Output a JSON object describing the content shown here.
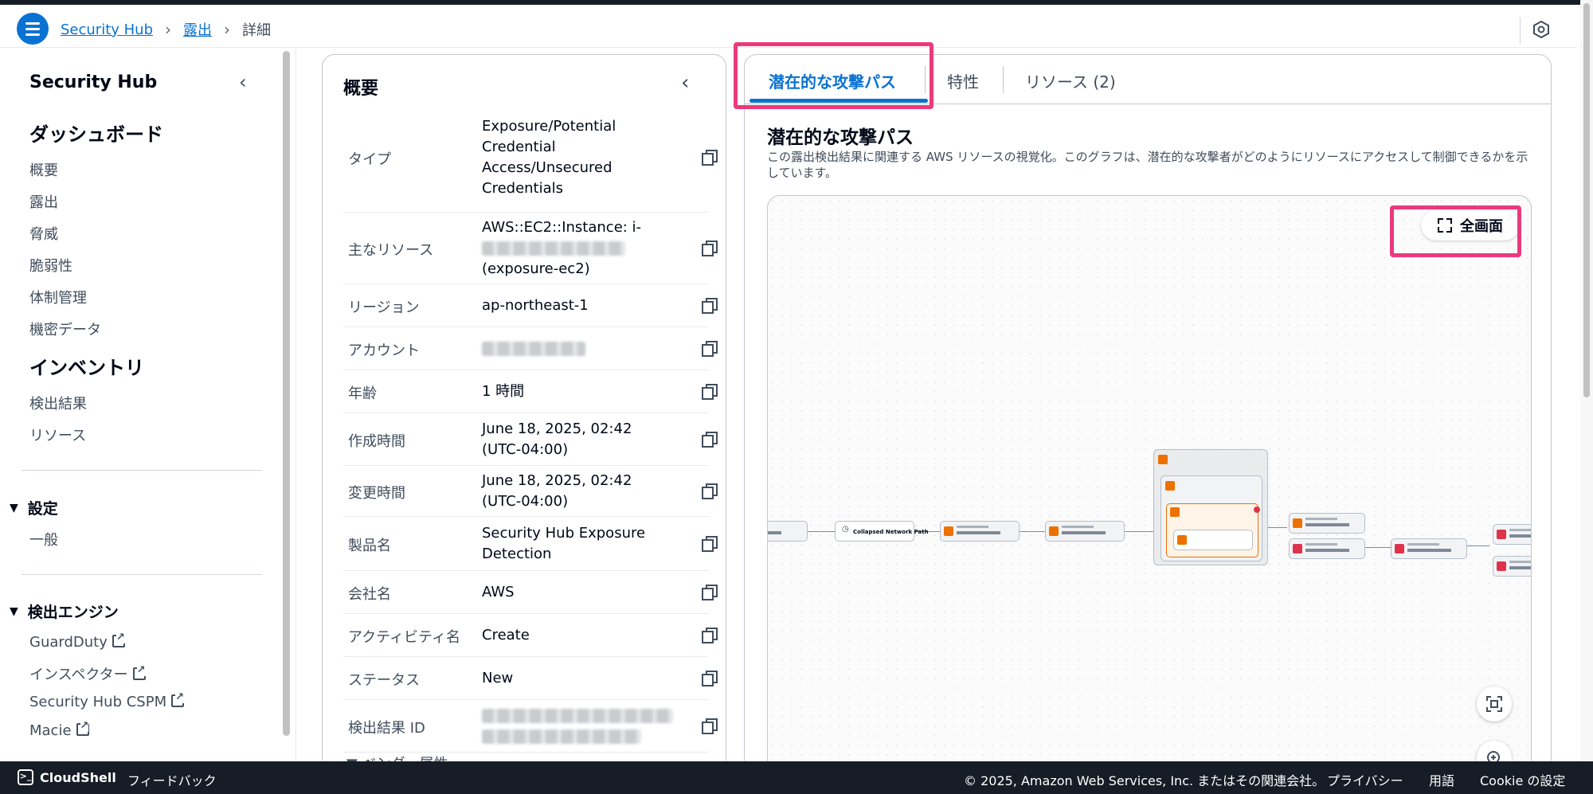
{
  "breadcrumb": [
    "Security Hub",
    "露出",
    "詳細"
  ],
  "sidebar": {
    "title": "Security Hub",
    "dashboard_heading": "ダッシュボード",
    "dashboard_items": [
      "概要",
      "露出",
      "脅威",
      "脆弱性",
      "体制管理",
      "機密データ"
    ],
    "inventory_heading": "インベントリ",
    "inventory_items": [
      "検出結果",
      "リソース"
    ],
    "settings_heading": "設定",
    "settings_items": [
      "一般"
    ],
    "engines_heading": "検出エンジン",
    "engine_items": [
      "GuardDuty",
      "インスペクター",
      "Security Hub CSPM",
      "Macie"
    ]
  },
  "overview": {
    "title": "概要",
    "rows": [
      {
        "key": "タイプ",
        "value": "Exposure/Potential Credential Access/Unsecured Credentials"
      },
      {
        "key": "主なリソース",
        "value_prefix": "AWS::EC2::Instance: i-",
        "value_suffix": "(exposure-ec2)"
      },
      {
        "key": "リージョン",
        "value": "ap-northeast-1"
      },
      {
        "key": "アカウント",
        "value": ""
      },
      {
        "key": "年齢",
        "value": "1 時間"
      },
      {
        "key": "作成時間",
        "value": "June 18, 2025, 02:42 (UTC-04:00)"
      },
      {
        "key": "変更時間",
        "value": "June 18, 2025, 02:42 (UTC-04:00)"
      },
      {
        "key": "製品名",
        "value": "Security Hub Exposure Detection"
      },
      {
        "key": "会社名",
        "value": "AWS"
      },
      {
        "key": "アクティビティ名",
        "value": "Create"
      },
      {
        "key": "ステータス",
        "value": "New"
      },
      {
        "key": "検出結果 ID",
        "value": ""
      }
    ],
    "vendor_attrs": "ベンダー属性"
  },
  "tabs": [
    {
      "label": "潜在的な攻撃パス",
      "active": true
    },
    {
      "label": "特性",
      "active": false
    },
    {
      "label": "リソース (2)",
      "active": false
    }
  ],
  "attack_path": {
    "title": "潜在的な攻撃パス",
    "description": "この露出検出結果に関連する AWS リソースの視覚化。このグラフは、潜在的な攻撃者がどのようにリソースにアクセスして制御できるかを示しています。",
    "fullscreen_label": "全画面",
    "collapsed_node_label": "Collapsed Network Path"
  },
  "footer": {
    "cloudshell": "CloudShell",
    "feedback": "フィードバック",
    "copyright": "© 2025, Amazon Web Services, Inc. またはその関連会社。",
    "privacy": "プライバシー",
    "terms": "用語",
    "cookie": "Cookie の設定"
  },
  "colors": {
    "accent": "#0972d3",
    "highlight": "#eb3a7c",
    "footer_bg": "#161d26",
    "ec2_orange": "#ed7100",
    "iam_red": "#dd344c"
  }
}
